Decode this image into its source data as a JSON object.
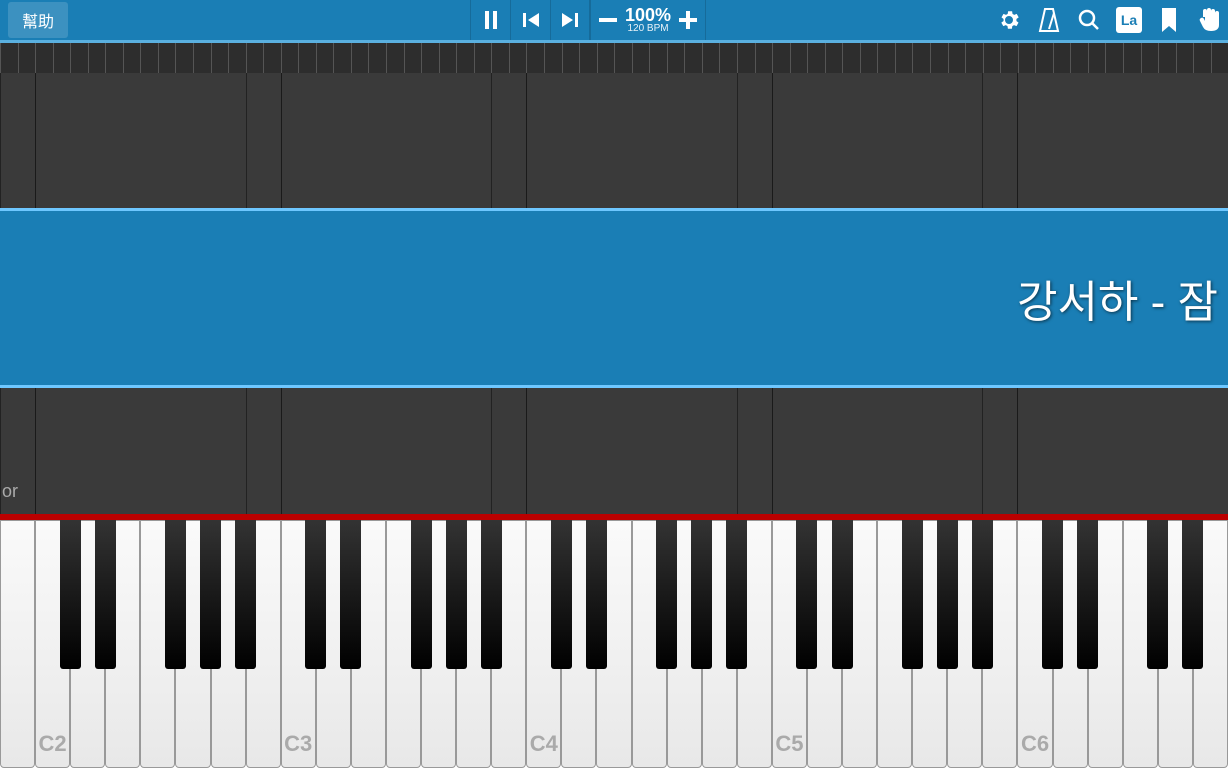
{
  "toolbar": {
    "help_label": "幫助",
    "tempo_percent": "100%",
    "tempo_bpm": "120 BPM",
    "notation_label": "La"
  },
  "song": {
    "title_visible": "강서하 - 잠"
  },
  "note_area": {
    "bottom_label": "or"
  },
  "keyboard": {
    "white_keys": 35,
    "octave_labels": [
      "C2",
      "C3",
      "C4",
      "C5",
      "C6"
    ],
    "octave_positions": [
      1,
      8,
      15,
      22,
      29
    ]
  },
  "colors": {
    "primary": "#1a7eb5",
    "accent": "#5ab0e0"
  }
}
